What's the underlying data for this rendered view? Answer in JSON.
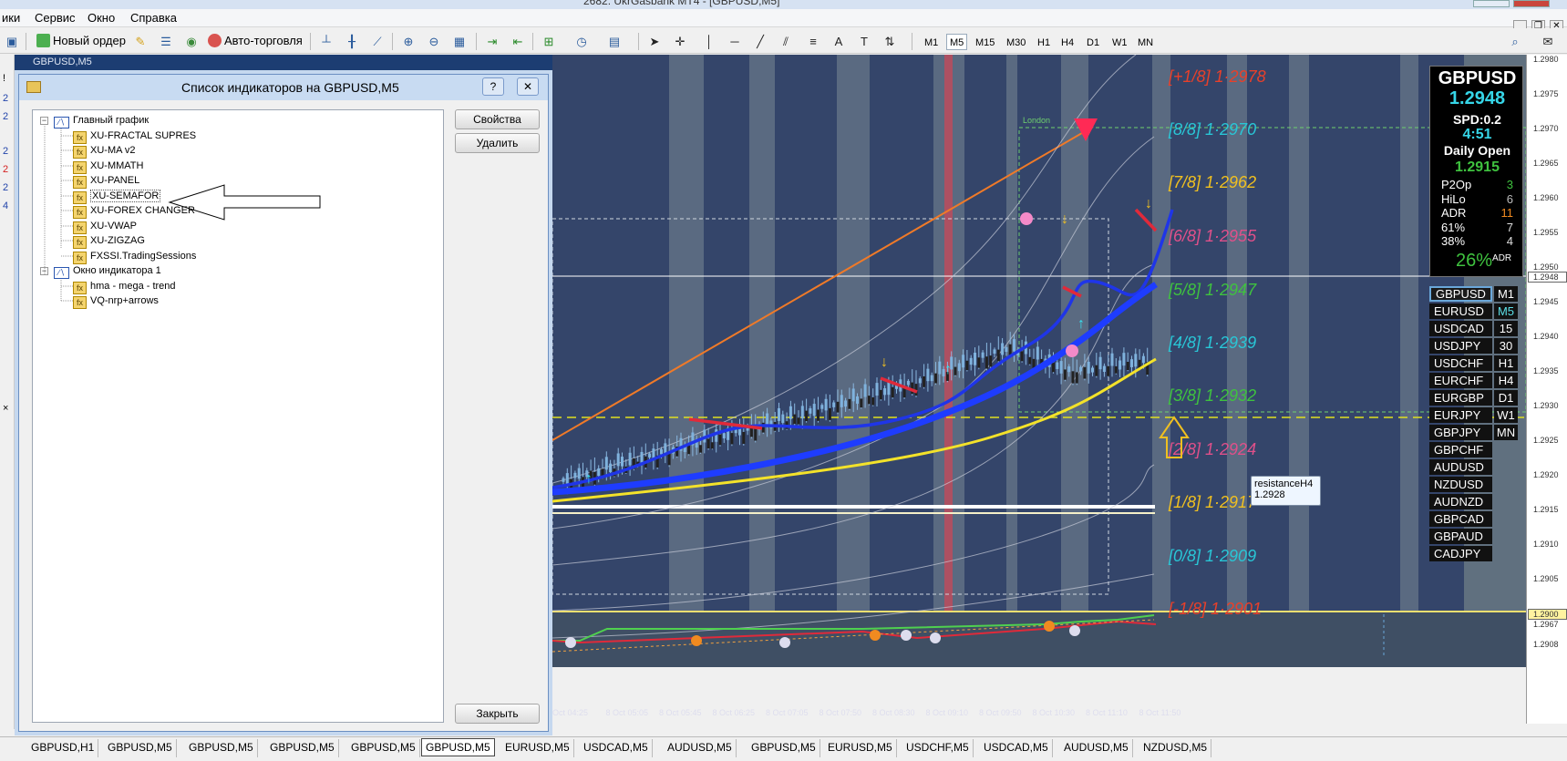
{
  "window": {
    "title": "2682: UkrGasbank MT4 - [GBPUSD,M5]"
  },
  "menu": [
    "ики",
    "Сервис",
    "Окно",
    "Справка"
  ],
  "toolbar": {
    "new_order": "Новый ордер",
    "auto_trading": "Авто-торговля",
    "timeframes": [
      "M1",
      "M5",
      "M15",
      "M30",
      "H1",
      "H4",
      "D1",
      "W1",
      "MN"
    ],
    "active_timeframe": "M5"
  },
  "left_strip": [
    "!",
    "2",
    "2",
    "2",
    "2",
    "2",
    "4",
    "×"
  ],
  "chart_header": "GBPUSD,M5",
  "dialog": {
    "title": "Список индикаторов на GBPUSD,M5",
    "help_label": "?",
    "close_label": "✕",
    "properties_button": "Свойства",
    "delete_button": "Удалить",
    "close_button": "Закрыть",
    "groups": [
      {
        "name": "Главный график",
        "items": [
          "XU-FRACTAL SUPRES",
          "XU-MA v2",
          "XU-MMATH",
          "XU-PANEL",
          "XU-SEMAFOR",
          "XU-FOREX CHANGER",
          "XU-VWAP",
          "XU-ZIGZAG",
          "FXSSI.TradingSessions"
        ]
      },
      {
        "name": "Окно индикатора 1",
        "items": [
          "hma - mega - trend",
          "VQ-nrp+arrows"
        ]
      }
    ],
    "selected_item": "XU-SEMAFOR"
  },
  "murrey_levels": [
    {
      "label": "[+1/8]",
      "value": "1.2978",
      "color": "#e8402a"
    },
    {
      "label": "[8/8]",
      "value": "1.2970",
      "color": "#29c6d6"
    },
    {
      "label": "[7/8]",
      "value": "1.2962",
      "color": "#f0c020"
    },
    {
      "label": "[6/8]",
      "value": "1.2955",
      "color": "#e0508a"
    },
    {
      "label": "[5/8]",
      "value": "1.2947",
      "color": "#3fc23f"
    },
    {
      "label": "[4/8]",
      "value": "1.2939",
      "color": "#29c6d6"
    },
    {
      "label": "[3/8]",
      "value": "1.2932",
      "color": "#3fc23f"
    },
    {
      "label": "[2/8]",
      "value": "1.2924",
      "color": "#e0508a"
    },
    {
      "label": "[1/8]",
      "value": "1.2917",
      "color": "#f0c020"
    },
    {
      "label": "[0/8]",
      "value": "1.2909",
      "color": "#29c6d6"
    },
    {
      "label": "[-1/8]",
      "value": "1.2901",
      "color": "#e8402a"
    }
  ],
  "session_label": "London",
  "tooltip": {
    "name": "resistanceH4",
    "value": "1.2928"
  },
  "panel": {
    "symbol": "GBPUSD",
    "price": "1.2948",
    "spread": "SPD:0.2",
    "timer": "4:51",
    "daily_open_label": "Daily Open",
    "daily_open": "1.2915",
    "stats": [
      {
        "label": "P2Op",
        "value": "3",
        "color": "#3fc23f"
      },
      {
        "label": "HiLo",
        "value": "6",
        "color": "#bbbbbb"
      },
      {
        "label": "ADR",
        "value": "11",
        "color": "#f08a20"
      },
      {
        "label": "61%",
        "value": "7",
        "color": "#dddddd"
      },
      {
        "label": "38%",
        "value": "4",
        "color": "#dddddd"
      }
    ],
    "adr_percent": "26%",
    "adr_suffix": "ADR"
  },
  "symbols": [
    "GBPUSD",
    "EURUSD",
    "USDCAD",
    "USDJPY",
    "USDCHF",
    "EURCHF",
    "EURGBP",
    "EURJPY",
    "GBPJPY",
    "GBPCHF",
    "AUDUSD",
    "NZDUSD",
    "AUDNZD",
    "GBPCAD",
    "GBPAUD",
    "CADJPY"
  ],
  "symbol_timeframes": [
    "M1",
    "M5",
    "15",
    "30",
    "H1",
    "H4",
    "D1",
    "W1",
    "MN"
  ],
  "price_scale": [
    "1.2980",
    "1.2975",
    "1.2970",
    "1.2965",
    "1.2960",
    "1.2955",
    "1.2950",
    "1.2948",
    "1.2945",
    "1.2940",
    "1.2935",
    "1.2930",
    "1.2925",
    "1.2920",
    "1.2915",
    "1.2910",
    "1.2905",
    "1.2900",
    "1.2967",
    "1.2908"
  ],
  "time_axis": [
    "Oct 04:25",
    "8 Oct 05:05",
    "8 Oct 05:45",
    "8 Oct 06:25",
    "8 Oct 07:05",
    "8 Oct 07:50",
    "8 Oct 08:30",
    "8 Oct 09:10",
    "8 Oct 09:50",
    "8 Oct 10:30",
    "8 Oct 11:10",
    "8 Oct 11:50"
  ],
  "tabs": [
    "GBPUSD,H1",
    "GBPUSD,M5",
    "GBPUSD,M5",
    "GBPUSD,M5",
    "GBPUSD,M5",
    "GBPUSD,M5",
    "EURUSD,M5",
    "USDCAD,M5",
    "AUDUSD,M5",
    "GBPUSD,M5",
    "EURUSD,M5",
    "USDCHF,M5",
    "USDCAD,M5",
    "AUDUSD,M5",
    "NZDUSD,M5"
  ],
  "active_tab_index": 5
}
